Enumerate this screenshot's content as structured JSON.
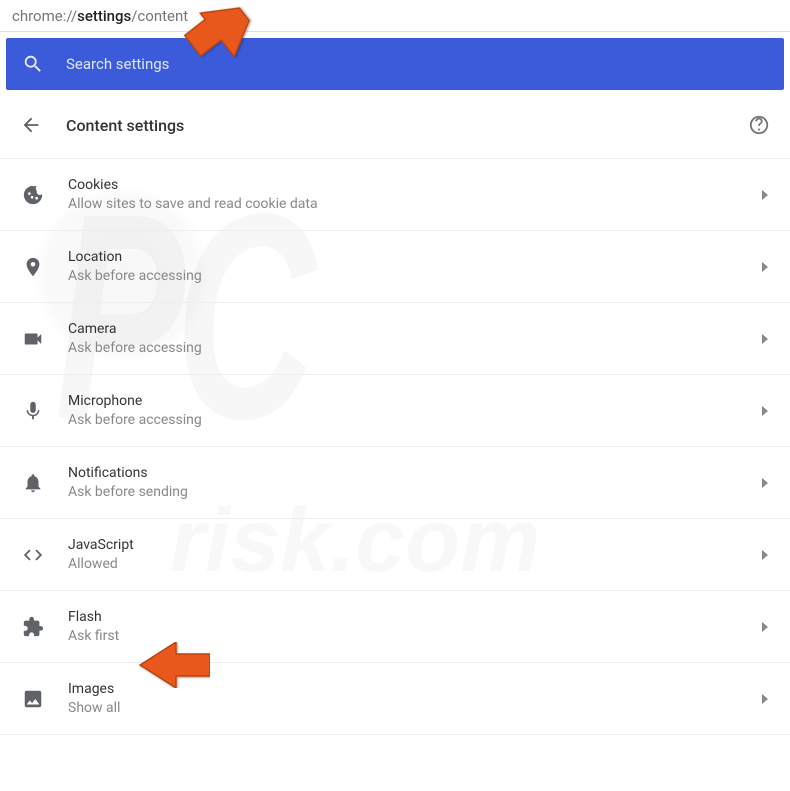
{
  "address": {
    "prefix": "chrome://",
    "bold": "settings",
    "suffix": "/content"
  },
  "search": {
    "placeholder": "Search settings"
  },
  "header": {
    "title": "Content settings"
  },
  "settings": [
    {
      "icon": "cookie-icon",
      "label": "Cookies",
      "sub": "Allow sites to save and read cookie data"
    },
    {
      "icon": "location-icon",
      "label": "Location",
      "sub": "Ask before accessing"
    },
    {
      "icon": "camera-icon",
      "label": "Camera",
      "sub": "Ask before accessing"
    },
    {
      "icon": "microphone-icon",
      "label": "Microphone",
      "sub": "Ask before accessing"
    },
    {
      "icon": "bell-icon",
      "label": "Notifications",
      "sub": "Ask before sending"
    },
    {
      "icon": "code-icon",
      "label": "JavaScript",
      "sub": "Allowed"
    },
    {
      "icon": "puzzle-icon",
      "label": "Flash",
      "sub": "Ask first"
    },
    {
      "icon": "image-icon",
      "label": "Images",
      "sub": "Show all"
    }
  ],
  "watermark": {
    "big": "PC",
    "small": "risk.com"
  }
}
